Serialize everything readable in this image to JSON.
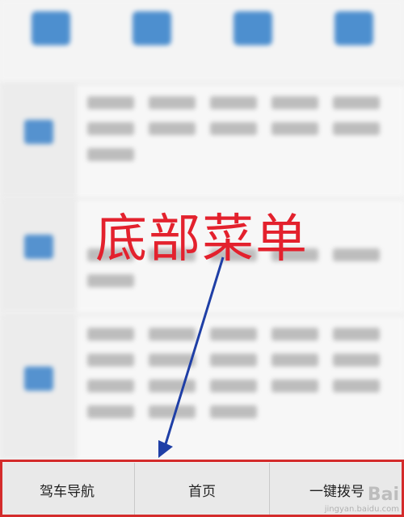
{
  "top_nav": [
    {
      "icon": "person-icon"
    },
    {
      "icon": "cloud-icon"
    },
    {
      "icon": "recycle-icon"
    },
    {
      "icon": "phone-icon"
    }
  ],
  "annotation": {
    "text": "底部菜单",
    "color": "#e3212d"
  },
  "bottom_menu": {
    "items": [
      "驾车导航",
      "首页",
      "一键拨号"
    ]
  },
  "watermark": {
    "main": "Bai",
    "sub": "jingyan.baidu.com"
  },
  "colors": {
    "accent": "#2f7cc8",
    "annotation": "#e3212d",
    "frame": "#d42b2b"
  }
}
